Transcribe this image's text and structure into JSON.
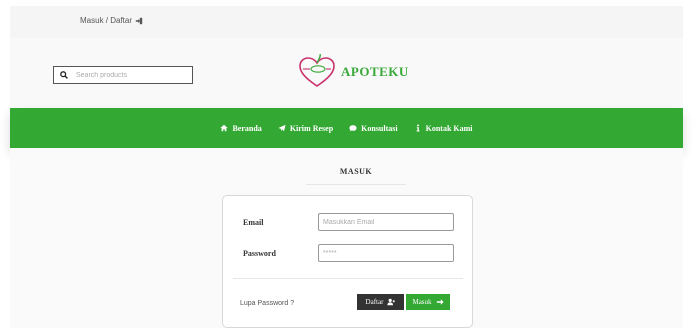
{
  "topbar": {
    "auth_label": "Masuk / Daftar"
  },
  "search": {
    "placeholder": "Search products"
  },
  "brand": {
    "name": "APOTEKU"
  },
  "nav": {
    "items": [
      {
        "label": "Beranda",
        "icon": "home-icon"
      },
      {
        "label": "Kirim Resep",
        "icon": "paper-plane-icon"
      },
      {
        "label": "Konsultasi",
        "icon": "comment-icon"
      },
      {
        "label": "Kontak Kami",
        "icon": "info-icon"
      }
    ]
  },
  "login": {
    "title": "MASUK",
    "email_label": "Email",
    "email_placeholder": "Masukkan Email",
    "password_label": "Password",
    "password_value": "*****",
    "forgot_label": "Lupa Password ?",
    "register_label": "Daftar",
    "submit_label": "Masuk"
  },
  "colors": {
    "brand_green": "#33a833",
    "dark_button": "#333333"
  }
}
